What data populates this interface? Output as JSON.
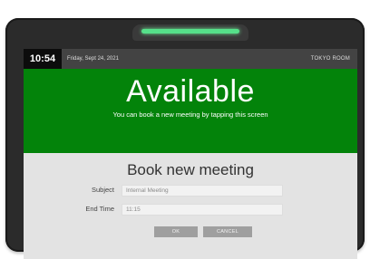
{
  "header": {
    "time": "10:54",
    "date": "Friday, Sept 24, 2021",
    "room": "TOKYO ROOM"
  },
  "status": {
    "title": "Available",
    "subtitle": "You can book a new meeting by tapping this screen",
    "color": "#03830a"
  },
  "form": {
    "title": "Book new meeting",
    "subject_label": "Subject",
    "subject_value": "Internal Meeting",
    "endtime_label": "End Time",
    "endtime_value": "11:15",
    "ok_label": "OK",
    "cancel_label": "CANCEL"
  },
  "device": {
    "led_color": "#56e08a"
  }
}
